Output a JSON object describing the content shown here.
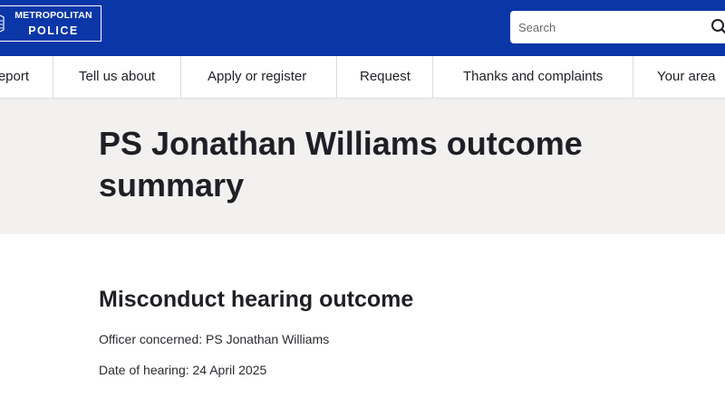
{
  "header": {
    "logo": {
      "line1": "METROPOLITAN",
      "line2": "POLICE"
    },
    "search": {
      "placeholder": "Search",
      "icon": "search-icon"
    },
    "colors": {
      "brand_blue": "#0a36a8",
      "banner_grey": "#f2f1f0",
      "text": "#1f1f25"
    }
  },
  "nav": {
    "items": [
      {
        "label": "Report"
      },
      {
        "label": "Tell us about"
      },
      {
        "label": "Apply or register"
      },
      {
        "label": "Request"
      },
      {
        "label": "Thanks and complaints"
      },
      {
        "label": "Your area"
      }
    ]
  },
  "banner": {
    "title": "PS Jonathan Williams outcome summary"
  },
  "content": {
    "heading": "Misconduct hearing outcome",
    "officer_line": "Officer concerned: PS Jonathan Williams",
    "date_line": "Date of hearing: 24 April 2025"
  }
}
